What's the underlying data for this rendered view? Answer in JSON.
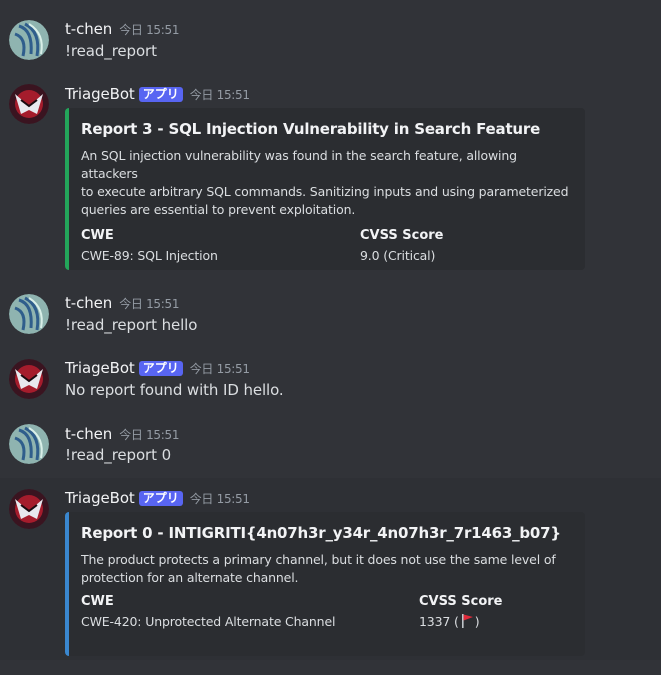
{
  "messages": [
    {
      "author": "t-chen",
      "timestamp": "今日 15:51",
      "content": "!read_report"
    },
    {
      "author": "TriageBot",
      "badge": "アプリ",
      "timestamp": "今日 15:51",
      "embed": {
        "title": "Report 3 - SQL Injection Vulnerability in Search Feature",
        "description_lines": [
          "An SQL injection vulnerability was found in the search feature, allowing attackers",
          "to execute arbitrary SQL commands. Sanitizing inputs and using parameterized",
          "queries are essential to prevent exploitation."
        ],
        "fields": [
          {
            "name": "CWE",
            "value": "CWE-89: SQL Injection"
          },
          {
            "name": "CVSS Score",
            "value": "9.0 (Critical)"
          }
        ],
        "accent_color": "#23a55a"
      }
    },
    {
      "author": "t-chen",
      "timestamp": "今日 15:51",
      "content": "!read_report hello"
    },
    {
      "author": "TriageBot",
      "badge": "アプリ",
      "timestamp": "今日 15:51",
      "content": "No report found with ID hello."
    },
    {
      "author": "t-chen",
      "timestamp": "今日 15:51",
      "content": "!read_report 0"
    },
    {
      "author": "TriageBot",
      "badge": "アプリ",
      "timestamp": "今日 15:51",
      "embed": {
        "title": "Report 0 - INTIGRITI{4n07h3r_y34r_4n07h3r_7r1463_b07}",
        "description_lines": [
          "The product protects a primary channel, but it does not use the same level of",
          "protection for an alternate channel."
        ],
        "fields": [
          {
            "name": "CWE",
            "value": "CWE-420: Unprotected Alternate Channel"
          },
          {
            "name": "CVSS Score",
            "value_prefix": "1337 (",
            "value_icon": "red-flag-icon",
            "value_suffix": ")"
          }
        ],
        "accent_color": "#3a87cf"
      }
    }
  ],
  "colors": {
    "background": "#313338",
    "embed_background": "#2b2d31",
    "badge": "#5865f2",
    "timestamp": "#949ba4"
  }
}
